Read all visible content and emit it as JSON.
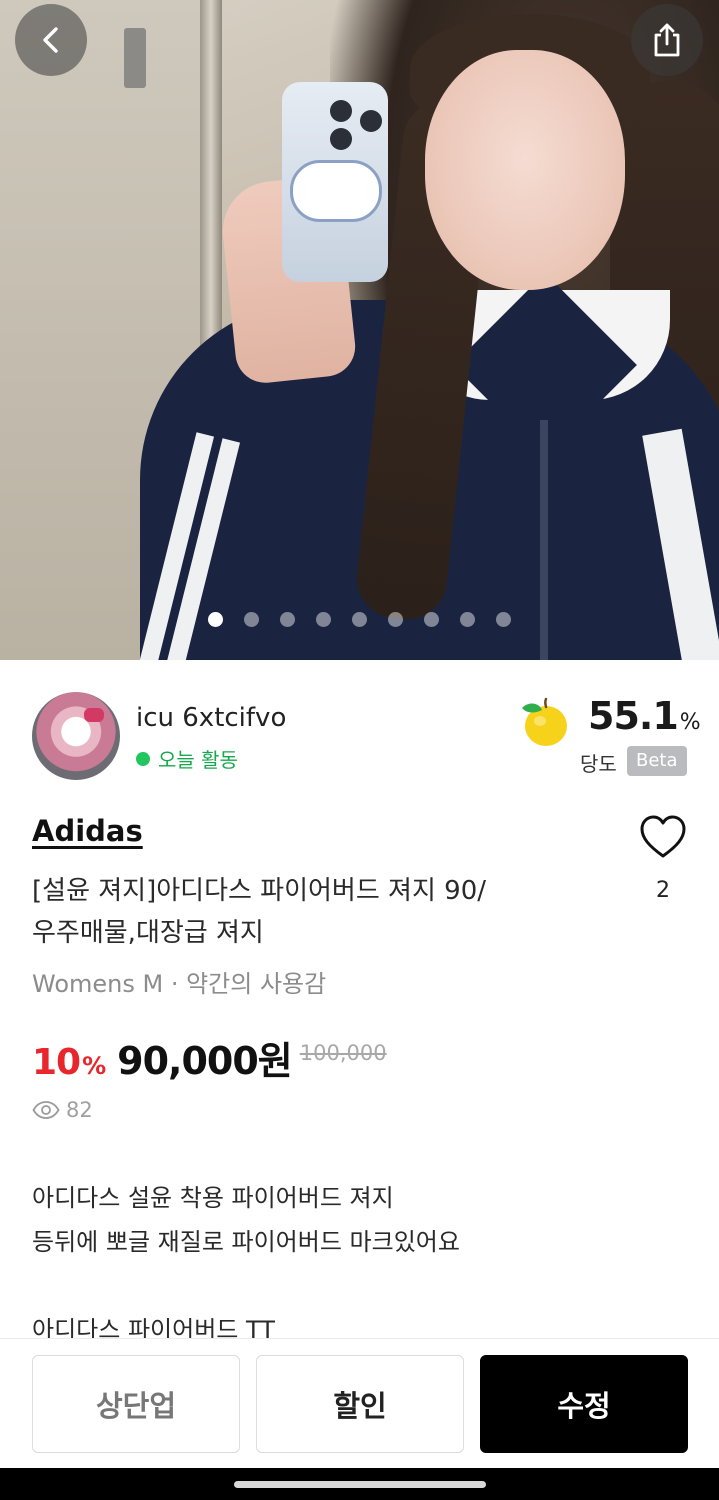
{
  "hero": {
    "image_count": 9,
    "active_index": 0,
    "icons": {
      "back": "chevron-left-icon",
      "share": "share-icon"
    }
  },
  "seller": {
    "name": "icu 6xtcifvo",
    "activity": "오늘 활동",
    "activity_color": "#22c55e"
  },
  "sweetness": {
    "icon": "yellow-apple-icon",
    "value": "55.1",
    "unit": "%",
    "label": "당도",
    "badge": "Beta"
  },
  "product": {
    "brand": "Adidas",
    "title_line1": "[설윤 져지]아디다스 파이어버드 져지 90/",
    "title_line2": "우주매물,대장급 져지",
    "subinfo": "Womens M · 약간의 사용감",
    "likes": "2",
    "discount": "10",
    "discount_unit": "%",
    "price": "90,000원",
    "original_price": "100,000",
    "views": "82",
    "discount_color": "#e8262c"
  },
  "description": {
    "line1": "아디다스 설윤 착용 파이어버드 져지",
    "line2": "등뒤에 뽀글 재질로 파이어버드 마크있어요",
    "line3": "아디다스 파이어버드 TT"
  },
  "actions": {
    "bump_label": "상단업",
    "discount_label": "할인",
    "edit_label": "수정"
  }
}
